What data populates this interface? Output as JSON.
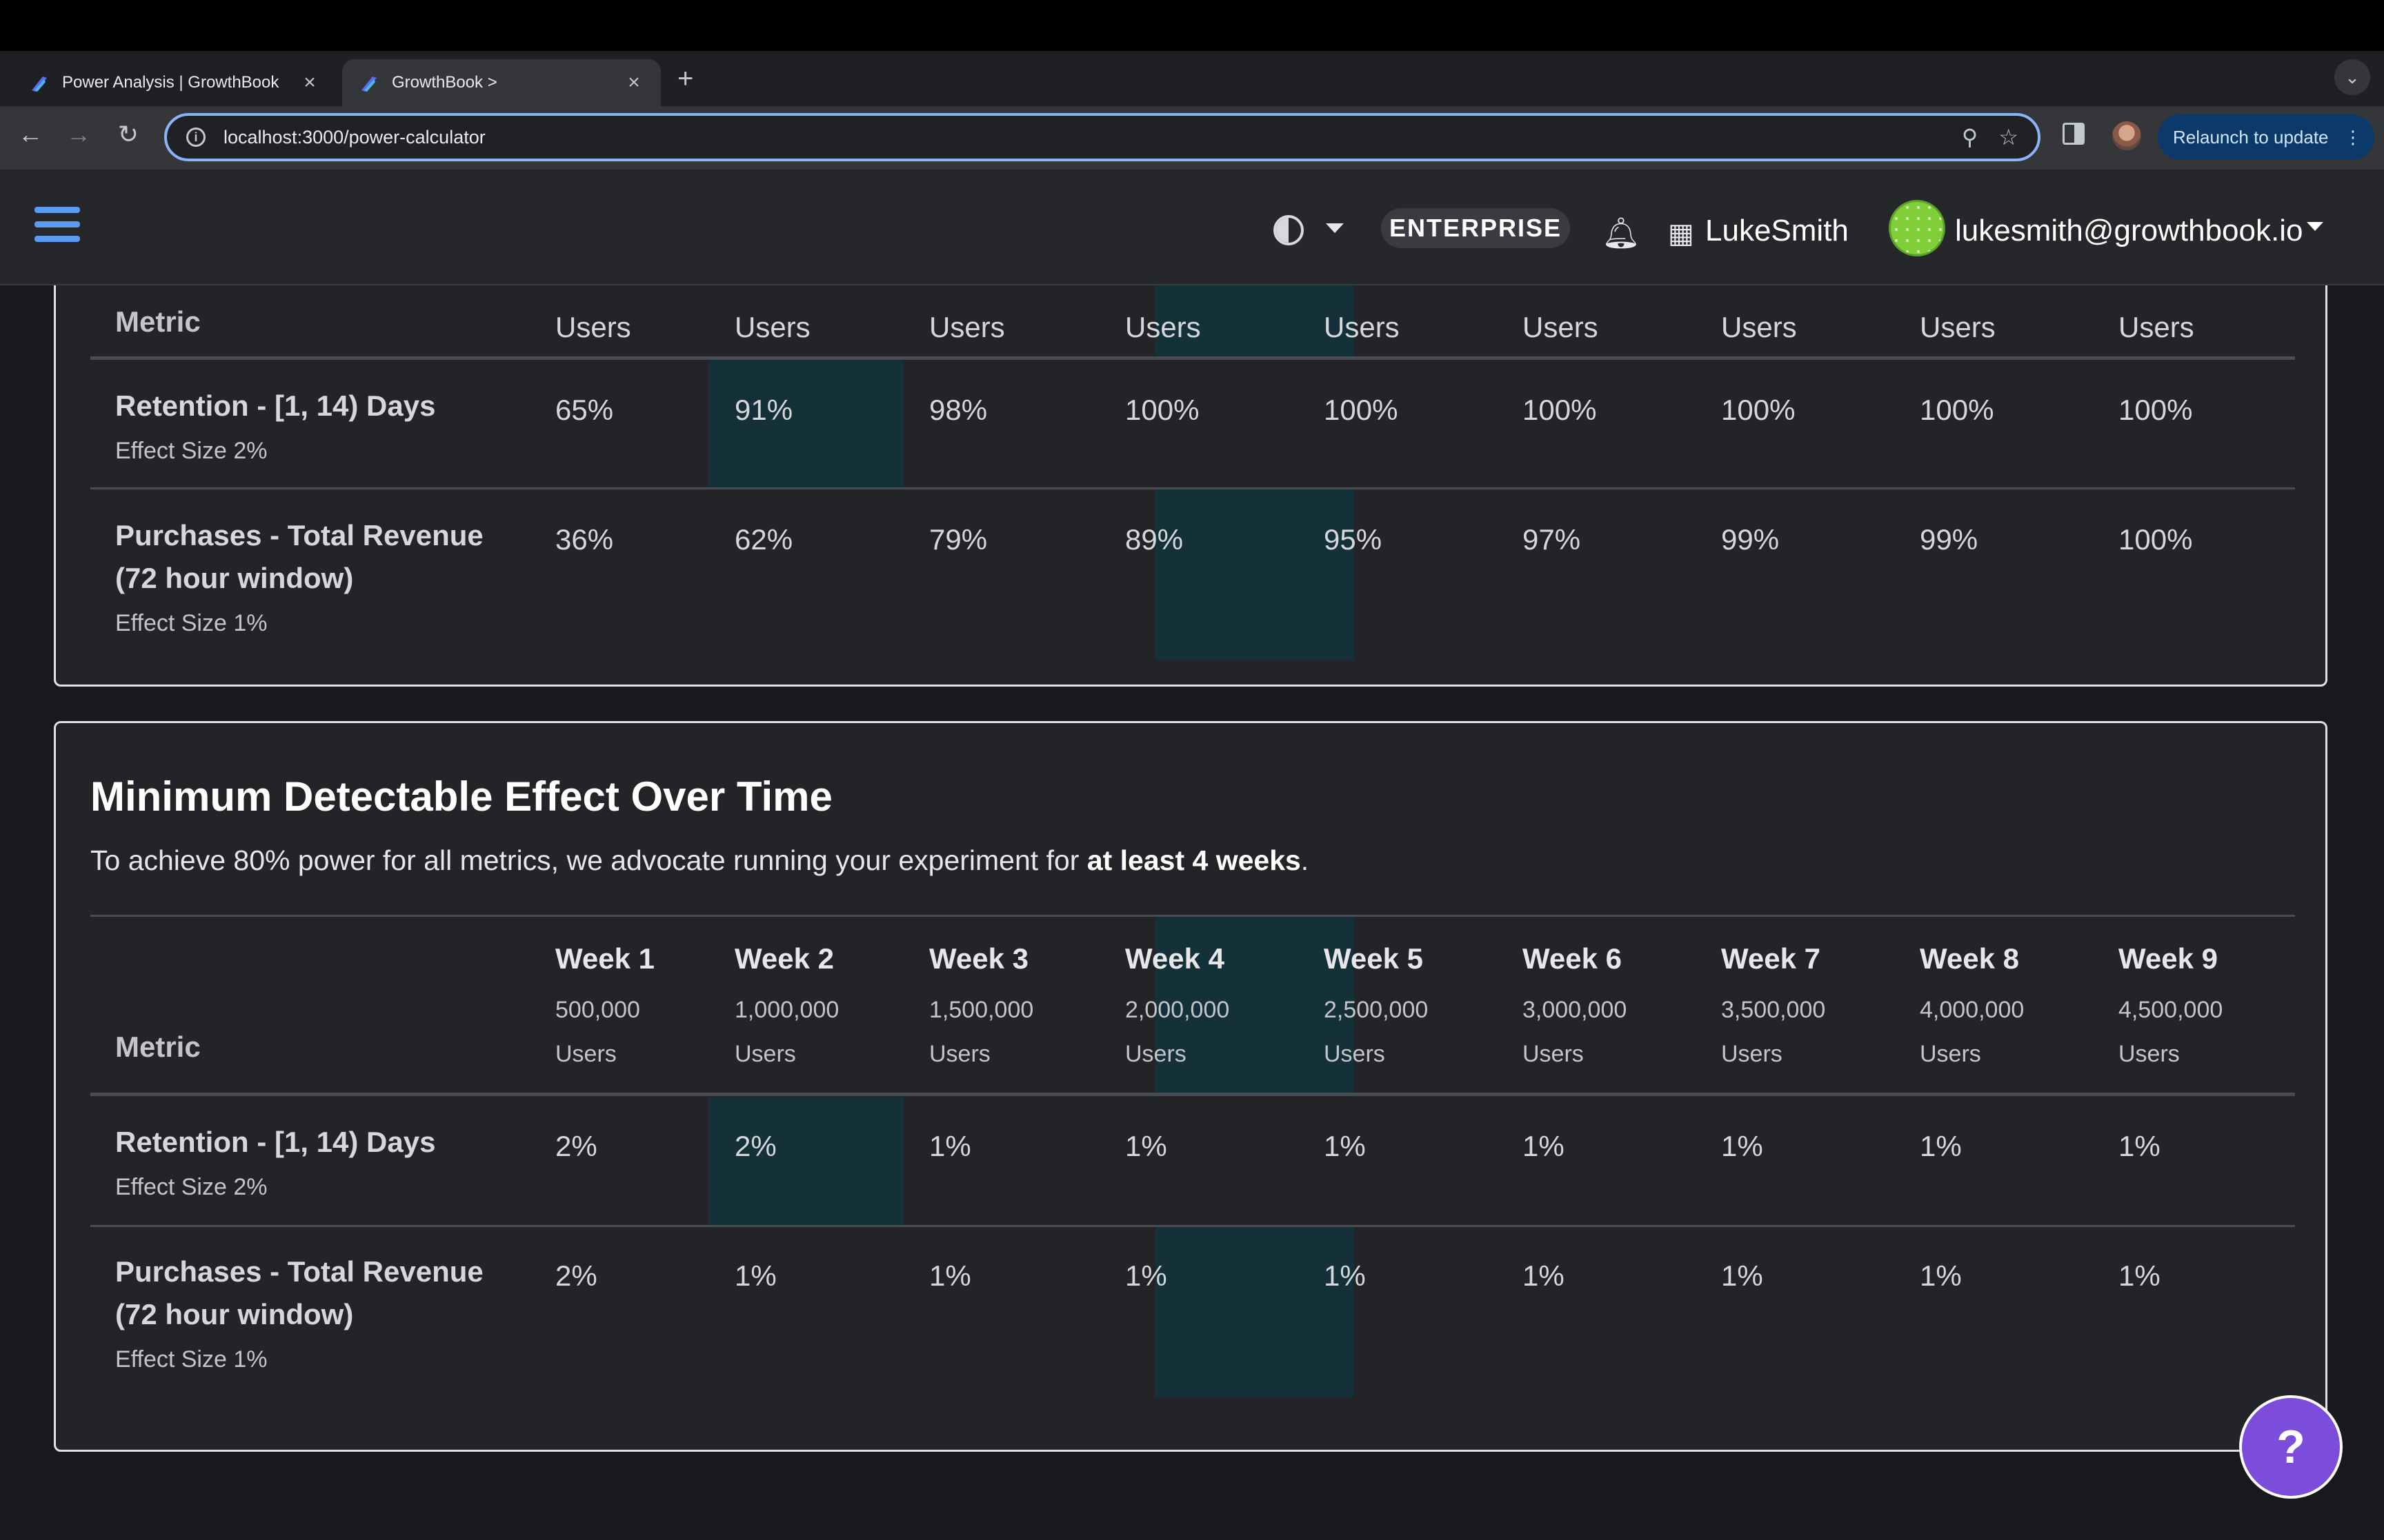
{
  "browser": {
    "tabs": [
      {
        "title": "Power Analysis | GrowthBook",
        "active": false
      },
      {
        "title": "GrowthBook >",
        "active": true
      }
    ],
    "url": "localhost:3000/power-calculator",
    "relaunch_label": "Relaunch to update"
  },
  "navbar": {
    "badge": "ENTERPRISE",
    "org_name": "LukeSmith",
    "user_email": "lukesmith@growthbook.io",
    "accent_color": "#5b9bf2"
  },
  "power_table": {
    "header": {
      "metric": "Metric",
      "users": [
        "Users",
        "Users",
        "Users",
        "Users",
        "Users",
        "Users",
        "Users",
        "Users",
        "Users"
      ]
    },
    "rows": [
      {
        "name_lines": [
          "Retention - [1, 14) Days"
        ],
        "effect": "Effect Size 2%",
        "values": [
          "65%",
          "91%",
          "98%",
          "100%",
          "100%",
          "100%",
          "100%",
          "100%",
          "100%"
        ]
      },
      {
        "name_lines": [
          "Purchases - Total Revenue",
          "(72 hour window)"
        ],
        "effect": "Effect Size 1%",
        "values": [
          "36%",
          "62%",
          "79%",
          "89%",
          "95%",
          "97%",
          "99%",
          "99%",
          "100%"
        ]
      }
    ]
  },
  "mde_section": {
    "title": "Minimum Detectable Effect Over Time",
    "description_prefix": "To achieve 80% power for all metrics, we advocate running your experiment for ",
    "description_bold": "at least 4 weeks",
    "description_suffix": ".",
    "metric_header": "Metric",
    "weeks": [
      {
        "label": "Week 1",
        "count": "500,000",
        "unit": "Users"
      },
      {
        "label": "Week 2",
        "count": "1,000,000",
        "unit": "Users"
      },
      {
        "label": "Week 3",
        "count": "1,500,000",
        "unit": "Users"
      },
      {
        "label": "Week 4",
        "count": "2,000,000",
        "unit": "Users"
      },
      {
        "label": "Week 5",
        "count": "2,500,000",
        "unit": "Users"
      },
      {
        "label": "Week 6",
        "count": "3,000,000",
        "unit": "Users"
      },
      {
        "label": "Week 7",
        "count": "3,500,000",
        "unit": "Users"
      },
      {
        "label": "Week 8",
        "count": "4,000,000",
        "unit": "Users"
      },
      {
        "label": "Week 9",
        "count": "4,500,000",
        "unit": "Users"
      }
    ],
    "rows": [
      {
        "name_lines": [
          "Retention - [1, 14) Days"
        ],
        "effect": "Effect Size 2%",
        "values": [
          "2%",
          "2%",
          "1%",
          "1%",
          "1%",
          "1%",
          "1%",
          "1%",
          "1%"
        ]
      },
      {
        "name_lines": [
          "Purchases - Total Revenue",
          "(72 hour window)"
        ],
        "effect": "Effect Size 1%",
        "values": [
          "2%",
          "1%",
          "1%",
          "1%",
          "1%",
          "1%",
          "1%",
          "1%",
          "1%"
        ]
      }
    ]
  },
  "help_button": "?",
  "colors": {
    "highlight": "#143139",
    "help_button": "#7c4ddb"
  }
}
